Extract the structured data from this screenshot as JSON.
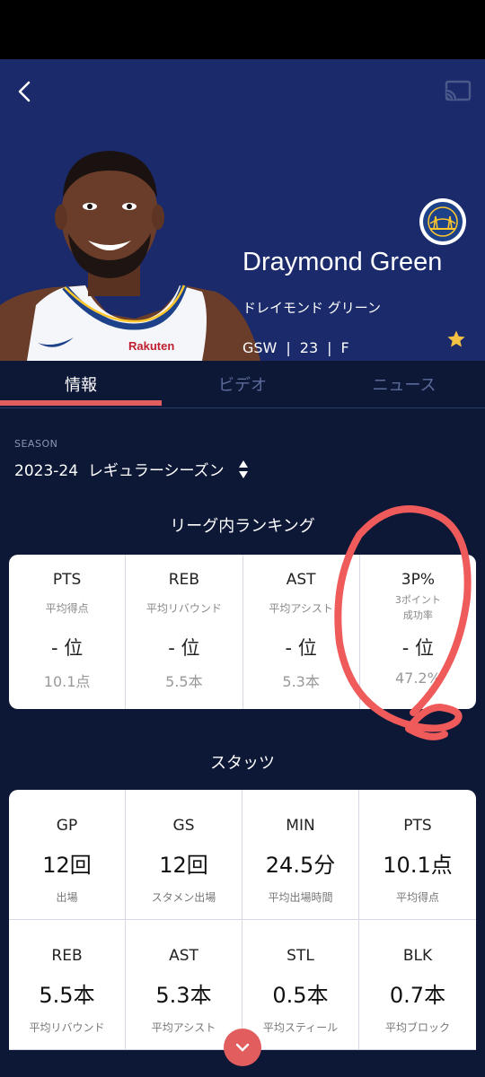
{
  "header": {
    "player_name": "Draymond Green",
    "player_name_jp": "ドレイモンド グリーン",
    "team": "GSW",
    "number": "23",
    "position": "F",
    "separator": "|"
  },
  "tabs": [
    {
      "label": "情報",
      "active": true
    },
    {
      "label": "ビデオ",
      "active": false
    },
    {
      "label": "ニュース",
      "active": false
    }
  ],
  "season": {
    "label": "SEASON",
    "value": "2023-24  レギュラーシーズン"
  },
  "ranking": {
    "title": "リーグ内ランキング",
    "items": [
      {
        "abbr": "PTS",
        "sub": "平均得点",
        "rank": "- 位",
        "value": "10.1点"
      },
      {
        "abbr": "REB",
        "sub": "平均リバウンド",
        "rank": "- 位",
        "value": "5.5本"
      },
      {
        "abbr": "AST",
        "sub": "平均アシスト",
        "rank": "- 位",
        "value": "5.3本"
      },
      {
        "abbr": "3P%",
        "sub": "3ポイント\n成功率",
        "rank": "- 位",
        "value": "47.2%"
      }
    ]
  },
  "stats": {
    "title": "スタッツ",
    "items": [
      {
        "abbr": "GP",
        "value": "12回",
        "sub": "出場"
      },
      {
        "abbr": "GS",
        "value": "12回",
        "sub": "スタメン出場"
      },
      {
        "abbr": "MIN",
        "value": "24.5分",
        "sub": "平均出場時間"
      },
      {
        "abbr": "PTS",
        "value": "10.1点",
        "sub": "平均得点"
      },
      {
        "abbr": "REB",
        "value": "5.5本",
        "sub": "平均リバウンド"
      },
      {
        "abbr": "AST",
        "value": "5.3本",
        "sub": "平均アシスト"
      },
      {
        "abbr": "STL",
        "value": "0.5本",
        "sub": "平均スティール"
      },
      {
        "abbr": "BLK",
        "value": "0.7本",
        "sub": "平均ブロック"
      }
    ]
  },
  "icons": {
    "back": "back-arrow-icon",
    "cast": "cast-icon",
    "favorite": "star-icon",
    "season_picker": "sort-arrows-icon",
    "scroll": "chevron-down-icon"
  },
  "colors": {
    "hero_bg": "#1b2a6b",
    "page_bg": "#0d1736",
    "accent": "#e25e5e",
    "star": "#f3c244",
    "annotation": "#ef5b5b"
  }
}
